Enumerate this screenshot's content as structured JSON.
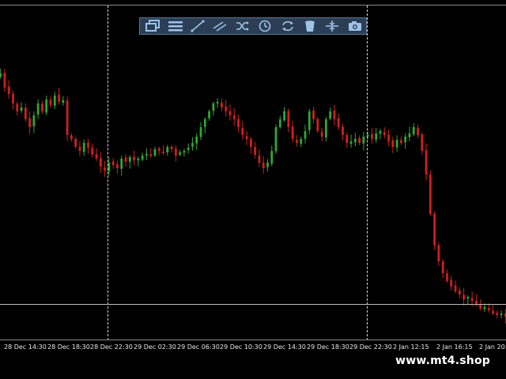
{
  "toolbar": {
    "buttons": [
      {
        "icon": "windows-icon",
        "action": "tile-windows"
      },
      {
        "icon": "menu-icon",
        "action": "menu"
      },
      {
        "icon": "draw-line-icon",
        "action": "trendline"
      },
      {
        "icon": "parallel-lines-icon",
        "action": "channel"
      },
      {
        "icon": "shuffle-icon",
        "action": "random"
      },
      {
        "icon": "clock-icon",
        "action": "timeframe"
      },
      {
        "icon": "sync-icon",
        "action": "sync"
      },
      {
        "icon": "trash-icon",
        "action": "delete"
      },
      {
        "icon": "split-icon",
        "action": "separator"
      },
      {
        "icon": "camera-icon",
        "action": "screenshot"
      }
    ]
  },
  "time_axis": {
    "labels": [
      "28 Dec 14:30",
      "28 Dec 18:30",
      "28 Dec 22:30",
      "29 Dec 02:30",
      "29 Dec 06:30",
      "29 Dec 10:30",
      "29 Dec 14:30",
      "29 Dec 18:30",
      "29 Dec 22:30",
      "2 Jan 12:15",
      "2 Jan 16:15",
      "2 Jan 20:"
    ]
  },
  "watermark": "www.mt4.shop",
  "colors": {
    "bull": "#2fa82f",
    "bear": "#d01f1f",
    "background": "#000000",
    "toolbar_bg": "#2b3e55",
    "toolbar_icon": "#9ec3ea"
  },
  "chart_data": {
    "type": "candlestick",
    "closes": [
      92,
      110,
      118,
      130,
      140,
      135,
      150,
      160,
      145,
      130,
      140,
      125,
      132,
      120,
      128,
      126,
      170,
      175,
      185,
      190,
      180,
      186,
      195,
      200,
      210,
      215,
      205,
      208,
      212,
      200,
      204,
      198,
      202,
      200,
      196,
      194,
      195,
      188,
      190,
      192,
      185,
      188,
      196,
      192,
      190,
      186,
      180,
      172,
      160,
      150,
      140,
      130,
      128,
      135,
      140,
      145,
      150,
      160,
      170,
      175,
      185,
      195,
      205,
      212,
      205,
      190,
      160,
      150,
      140,
      160,
      175,
      180,
      175,
      165,
      140,
      150,
      165,
      172,
      150,
      140,
      150,
      160,
      170,
      180,
      178,
      175,
      180,
      172,
      170,
      175,
      168,
      165,
      170,
      178,
      185,
      176,
      180,
      172,
      168,
      160,
      170,
      190,
      220,
      270,
      310,
      330,
      345,
      355,
      362,
      368,
      372,
      378,
      375,
      380,
      385,
      390,
      388,
      392,
      396,
      398,
      396,
      400
    ]
  }
}
